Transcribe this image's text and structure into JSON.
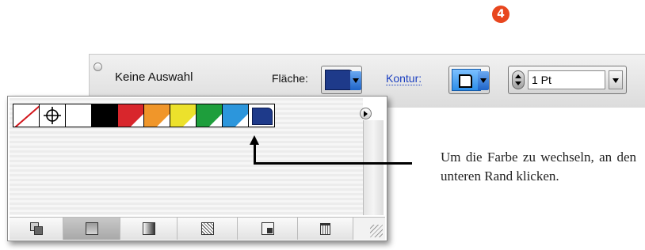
{
  "step": {
    "number": "4",
    "color": "#e8461e"
  },
  "control_bar": {
    "selection_label": "Keine Auswahl",
    "fill_label": "Fläche:",
    "fill_color": "#1e3a8a",
    "stroke_label": "Kontur:",
    "stroke_color": "#2d8ee8",
    "stroke_weight": "1 Pt"
  },
  "swatches_panel": {
    "swatches": [
      {
        "name": "none",
        "color": "#ffffff"
      },
      {
        "name": "registration",
        "color": "#ffffff"
      },
      {
        "name": "white",
        "color": "#ffffff"
      },
      {
        "name": "black",
        "color": "#000000"
      },
      {
        "name": "red",
        "color": "#d8262c"
      },
      {
        "name": "orange",
        "color": "#f0962a"
      },
      {
        "name": "yellow",
        "color": "#ece12c"
      },
      {
        "name": "green",
        "color": "#1e9e3c"
      },
      {
        "name": "blue",
        "color": "#2c96dc"
      },
      {
        "name": "dark-blue",
        "color": "#1e3a8a"
      }
    ],
    "bottom_buttons": [
      "show-all",
      "color",
      "gradient",
      "pattern",
      "new-swatch",
      "delete-swatch"
    ]
  },
  "caption": "Um die Farbe zu wechseln, an den unteren Rand klicken."
}
